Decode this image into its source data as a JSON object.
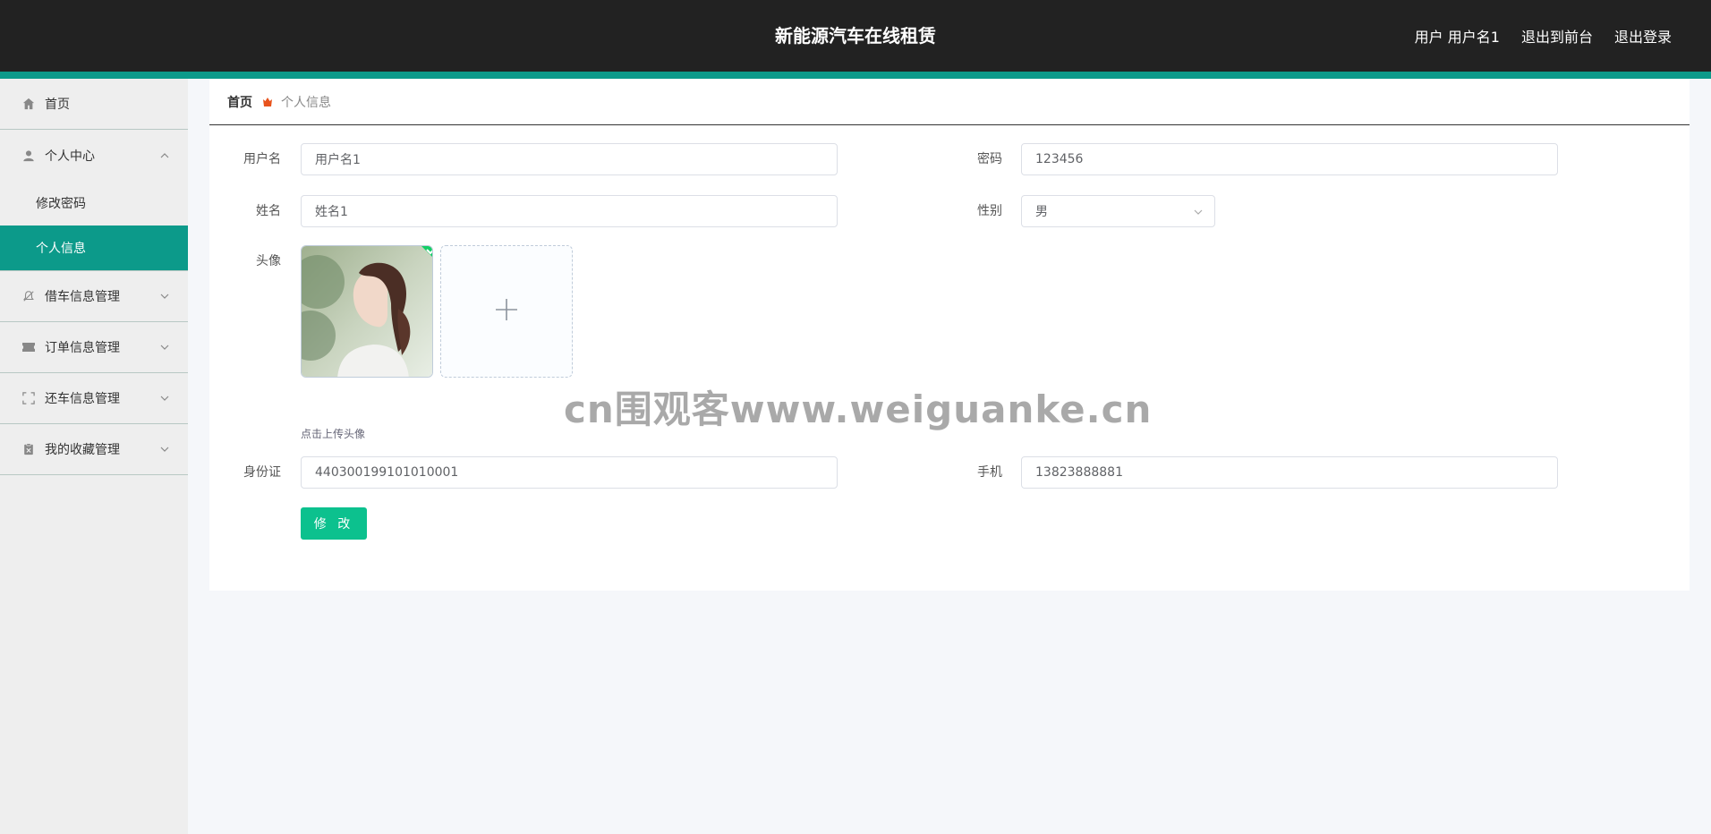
{
  "header": {
    "title": "新能源汽车在线租赁",
    "user_prefix": "用户",
    "username": "用户名1",
    "back_to_front": "退出到前台",
    "logout": "退出登录"
  },
  "sidebar": {
    "home": "首页",
    "personal_center": "个人中心",
    "change_password": "修改密码",
    "personal_info": "个人信息",
    "borrow_mgmt": "借车信息管理",
    "order_mgmt": "订单信息管理",
    "return_mgmt": "还车信息管理",
    "favorites_mgmt": "我的收藏管理"
  },
  "breadcrumb": {
    "home": "首页",
    "current": "个人信息"
  },
  "form": {
    "username_label": "用户名",
    "username_value": "用户名1",
    "password_label": "密码",
    "password_value": "123456",
    "name_label": "姓名",
    "name_value": "姓名1",
    "gender_label": "性别",
    "gender_value": "男",
    "avatar_label": "头像",
    "upload_hint": "点击上传头像",
    "id_label": "身份证",
    "id_value": "440300199101010001",
    "phone_label": "手机",
    "phone_value": "13823888881",
    "submit_label": "修 改"
  },
  "watermark": "cn围观客www.weiguanke.cn",
  "colors": {
    "header_bg": "#222222",
    "accent": "#0c9a8a",
    "button": "#0cc18e"
  }
}
